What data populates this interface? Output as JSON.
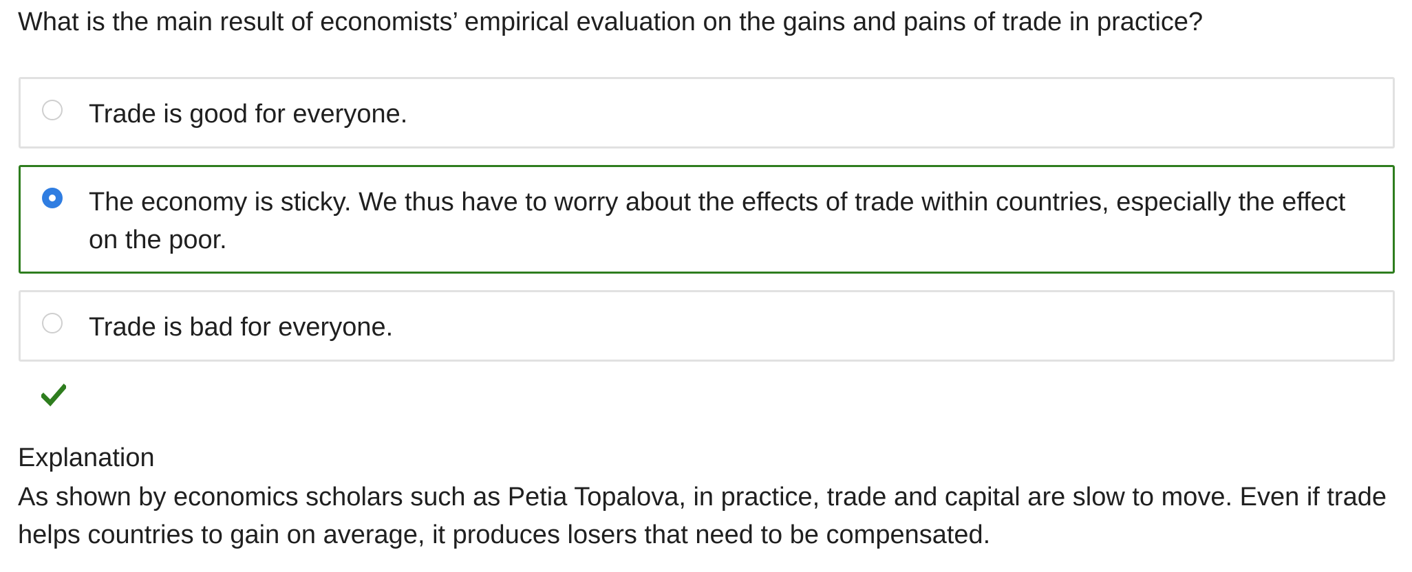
{
  "question": "What is the main result of economists’ empirical evaluation on the gains and pains of trade in practice?",
  "options": [
    {
      "label": "Trade is good for everyone.",
      "selected": false
    },
    {
      "label": "The economy is sticky. We thus have to worry about the effects of trade within countries, especially the effect on the poor.",
      "selected": true
    },
    {
      "label": "Trade is bad for everyone.",
      "selected": false
    }
  ],
  "result": {
    "icon": "check-icon",
    "status": "correct",
    "color": "#2e7d1e"
  },
  "explanation": {
    "heading": "Explanation",
    "body": "As shown by economics scholars such as Petia Topalova, in practice, trade and capital are slow to move. Even if trade helps countries to gain on average, it produces losers that need to be compensated."
  },
  "colors": {
    "selected_border": "#2e7d1e",
    "radio_selected": "#2f7de1",
    "option_border": "#e1e1e1"
  }
}
